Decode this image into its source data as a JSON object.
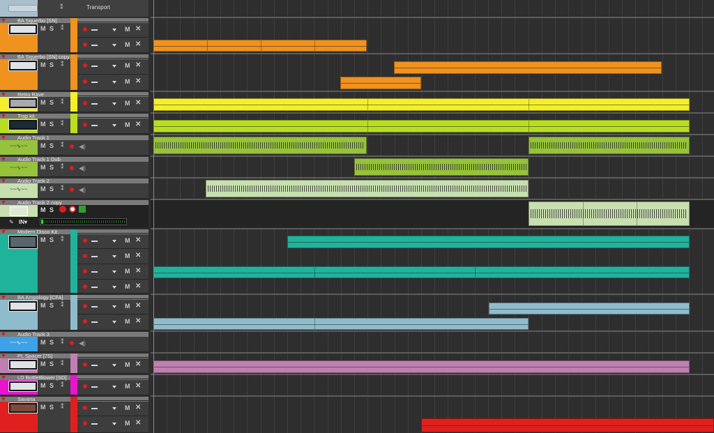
{
  "transport": {
    "name": "Transport",
    "icon": "waveform-icon"
  },
  "buttons": {
    "mute": "M",
    "solo": "S",
    "lane_mute": "M",
    "lane_delete": "✕",
    "monitor_in": "IN▾"
  },
  "colors": {
    "orange": "#f0921e",
    "yellow": "#f5ef2a",
    "lime": "#b9de20",
    "green": "#96c23c",
    "pale_green": "#c8dfb0",
    "teal": "#1fb39c",
    "light_blue": "#8fbccc",
    "blue": "#3ea2e8",
    "pink": "#c07fb2",
    "magenta": "#ea14cf",
    "red": "#e0201e",
    "grey_track": "#454545"
  },
  "tracks": [
    {
      "name": "BA Squerbo [SN]",
      "color": "#f0921e",
      "lanes": 2
    },
    {
      "name": "BA Squerbo [SN] copy",
      "color": "#f0921e",
      "lanes": 2
    },
    {
      "name": "Retro Rave",
      "color": "#f5ef2a",
      "lanes": 1
    },
    {
      "name": "Trap kit",
      "color": "#b9de20",
      "lanes": 1
    },
    {
      "name": "Audio Track 1",
      "color": "#96c23c",
      "lanes": 1,
      "audio": true
    },
    {
      "name": "Audio Track 1 Dub",
      "color": "#96c23c",
      "lanes": 1,
      "audio": true
    },
    {
      "name": "Audio Track 2",
      "color": "#c8dfb0",
      "lanes": 1,
      "audio": true
    },
    {
      "name": "Audio Track 2 copy",
      "color": "#c8dfb0",
      "lanes": 1,
      "audio": true,
      "selected": true
    },
    {
      "name": "Modern Disco Kit",
      "color": "#1fb39c",
      "lanes": 4
    },
    {
      "name": "BA Ampology [CFA]",
      "color": "#8fbccc",
      "lanes": 2
    },
    {
      "name": "Audio Track 3",
      "color": "#3ea2e8",
      "lanes": 1,
      "audio": true
    },
    {
      "name": "PL Spacer [7S]",
      "color": "#c07fb2",
      "lanes": 1
    },
    {
      "name": "LD BottleBlower [SD]",
      "color": "#ea14cf",
      "lanes": 1
    },
    {
      "name": "Savana",
      "color": "#e0201e",
      "lanes": 2
    }
  ]
}
